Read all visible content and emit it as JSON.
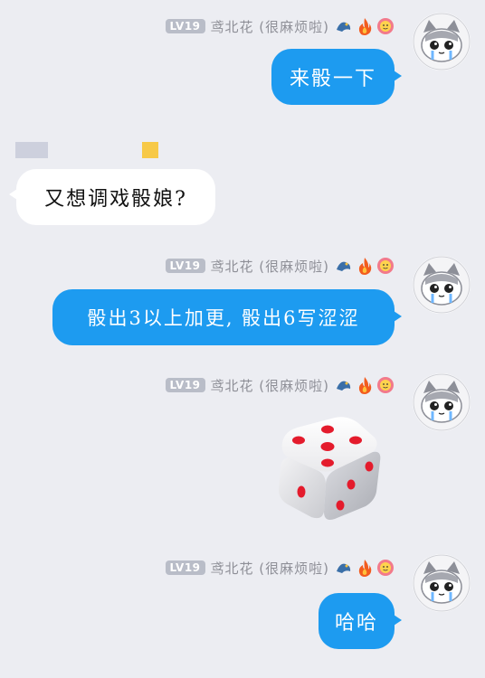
{
  "messages": [
    {
      "level": "LV19",
      "name": "鸢北花 (很麻烦啦)",
      "text": "来骰一下"
    },
    {
      "text": "又想调戏骰娘?"
    },
    {
      "level": "LV19",
      "name": "鸢北花 (很麻烦啦)",
      "text": "骰出3以上加更, 骰出6写涩涩"
    },
    {
      "level": "LV19",
      "name": "鸢北花 (很麻烦啦)",
      "dice_value": 5
    },
    {
      "level": "LV19",
      "name": "鸢北花 (很麻烦啦)",
      "text": "哈哈"
    }
  ],
  "colors": {
    "my_bubble": "#1d9bf0",
    "other_bubble": "#ffffff",
    "background": "#ecedf2",
    "dice_pip": "#e41b2c"
  },
  "icons": [
    "dragon-badge-icon",
    "fire-badge-icon",
    "flower-badge-icon",
    "cat-avatar-icon",
    "dice-icon"
  ]
}
